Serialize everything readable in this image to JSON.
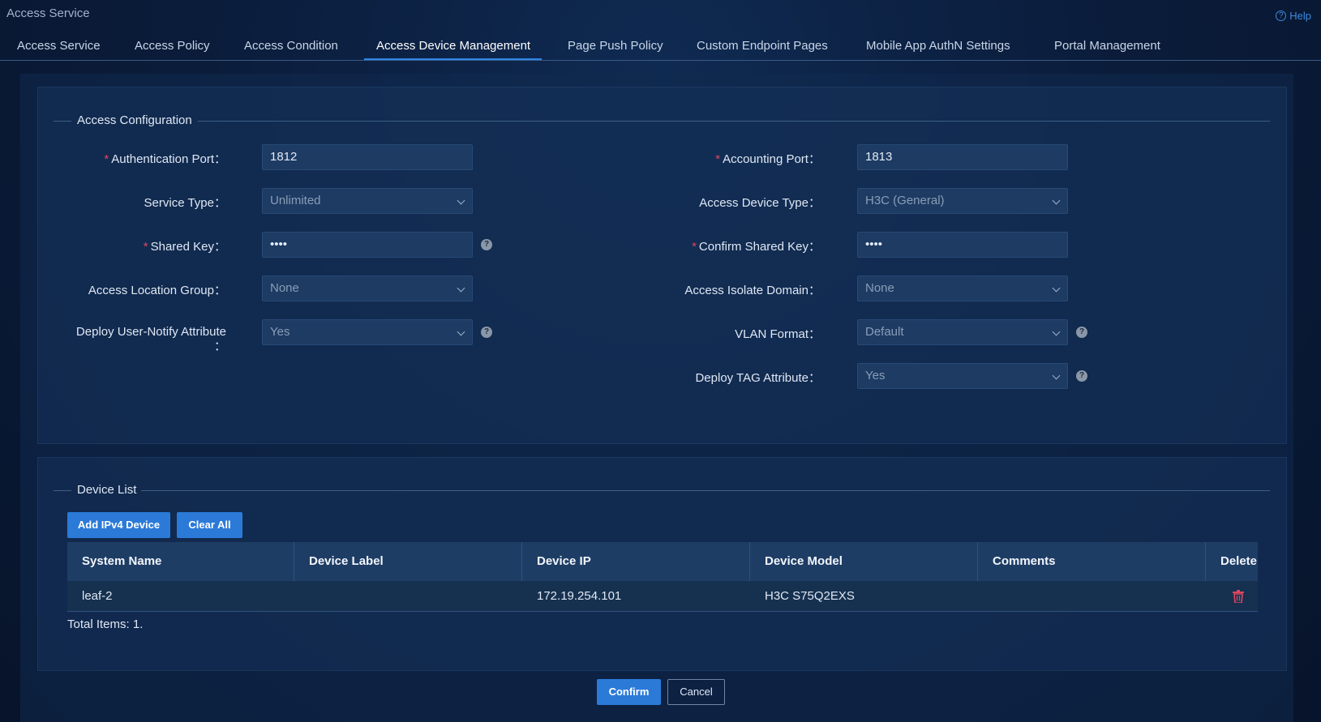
{
  "app": {
    "title": "Access Service",
    "help_label": "Help"
  },
  "tabs": [
    {
      "label": "Access Service"
    },
    {
      "label": "Access Policy"
    },
    {
      "label": "Access Condition"
    },
    {
      "label": "Access Device Management",
      "active": true
    },
    {
      "label": "Page Push Policy"
    },
    {
      "label": "Custom Endpoint Pages"
    },
    {
      "label": "Mobile App AuthN Settings"
    },
    {
      "label": "Portal Management"
    }
  ],
  "access_config": {
    "section_title": "Access Configuration",
    "auth_port": {
      "label": "Authentication Port",
      "value": "1812",
      "required": true
    },
    "acct_port": {
      "label": "Accounting Port",
      "value": "1813",
      "required": true
    },
    "service_type": {
      "label": "Service Type",
      "value": "Unlimited"
    },
    "device_type": {
      "label": "Access Device Type",
      "value": "H3C (General)"
    },
    "shared_key": {
      "label": "Shared Key",
      "value": "••••",
      "required": true
    },
    "confirm_key": {
      "label": "Confirm Shared Key",
      "value": "••••",
      "required": true
    },
    "location_group": {
      "label": "Access Location Group",
      "value": "None"
    },
    "isolate_domain": {
      "label": "Access Isolate Domain",
      "value": "None"
    },
    "user_notify": {
      "label": "Deploy User-Notify Attribute",
      "value": "Yes"
    },
    "vlan_format": {
      "label": "VLAN Format",
      "value": "Default"
    },
    "tag_attr": {
      "label": "Deploy TAG Attribute",
      "value": "Yes"
    },
    "colon": "："
  },
  "device_list": {
    "section_title": "Device List",
    "add_button": "Add IPv4 Device",
    "clear_button": "Clear All",
    "columns": [
      "System Name",
      "Device Label",
      "Device IP",
      "Device Model",
      "Comments",
      "Delete"
    ],
    "rows": [
      {
        "system_name": "leaf-2",
        "device_label": "",
        "device_ip": "172.19.254.101",
        "device_model": "H3C S75Q2EXS",
        "comments": ""
      }
    ],
    "total": "Total Items: 1."
  },
  "footer": {
    "confirm": "Confirm",
    "cancel": "Cancel"
  },
  "colors": {
    "accent": "#2b7ad8",
    "required": "#e0455f",
    "delete": "#e0455f"
  },
  "icons": {
    "help": "question-circle-icon",
    "info": "info-icon",
    "delete": "trash-icon",
    "dropdown": "chevron-down-icon"
  }
}
